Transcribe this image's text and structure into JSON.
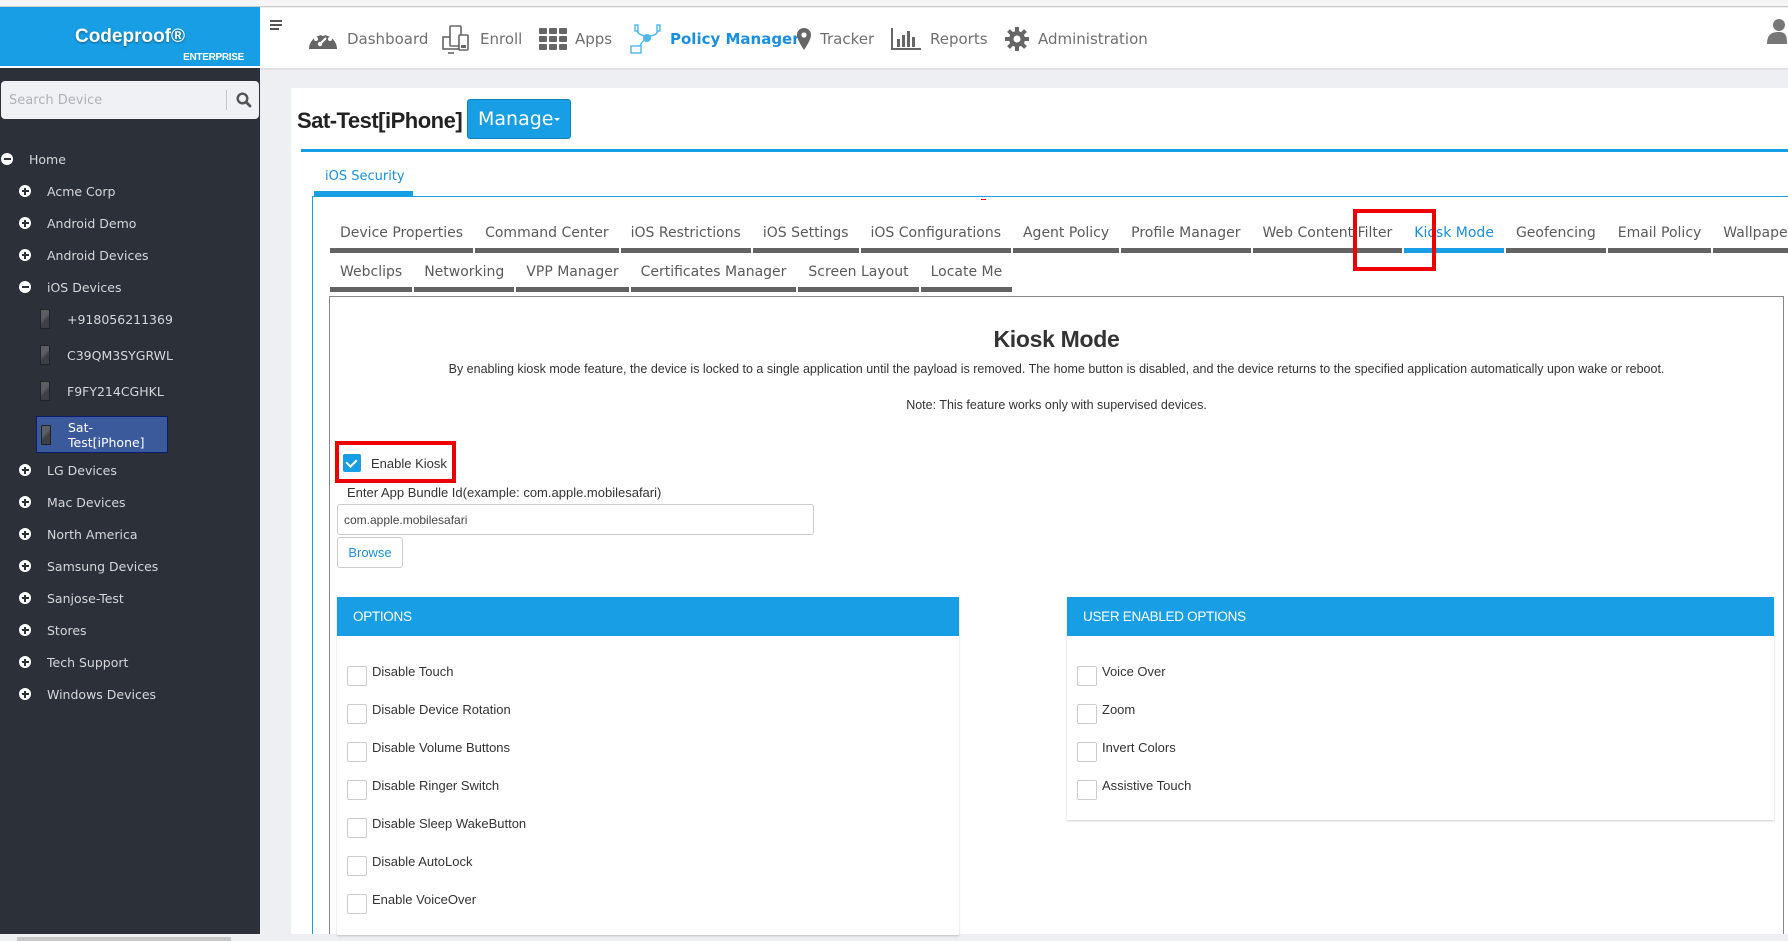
{
  "app": {
    "brand": "Codeproof®",
    "edition": "ENTERPRISE",
    "accent_color": "#189ee4",
    "highlight_color": "#ee0000"
  },
  "search": {
    "placeholder": "Search Device",
    "icon": "search-icon"
  },
  "sidebar": {
    "root": {
      "label": "Home",
      "icon": "collapse-icon"
    },
    "groups": [
      {
        "label": "Acme Corp",
        "icon": "expand-icon"
      },
      {
        "label": "Android Demo",
        "icon": "expand-icon"
      },
      {
        "label": "Android Devices",
        "icon": "expand-icon"
      },
      {
        "label": "iOS Devices",
        "icon": "collapse-icon"
      },
      {
        "label": "LG Devices",
        "icon": "expand-icon"
      },
      {
        "label": "Mac Devices",
        "icon": "expand-icon"
      },
      {
        "label": "North America",
        "icon": "expand-icon"
      },
      {
        "label": "Samsung Devices",
        "icon": "expand-icon"
      },
      {
        "label": "Sanjose-Test",
        "icon": "expand-icon"
      },
      {
        "label": "Stores",
        "icon": "expand-icon"
      },
      {
        "label": "Tech Support",
        "icon": "expand-icon"
      },
      {
        "label": "Windows Devices",
        "icon": "expand-icon"
      }
    ],
    "ios_devices": [
      {
        "label": "+918056211369",
        "selected": false
      },
      {
        "label": "C39QM3SYGRWL",
        "selected": false
      },
      {
        "label": "F9FY214CGHKL",
        "selected": false
      },
      {
        "label": "Sat-Test[iPhone]",
        "selected": true
      }
    ]
  },
  "topnav": {
    "menu_icon": "hamburger-icon",
    "items": [
      {
        "label": "Dashboard",
        "icon": "dashboard-gauge-icon",
        "active": false
      },
      {
        "label": "Enroll",
        "icon": "devices-icon",
        "active": false
      },
      {
        "label": "Apps",
        "icon": "apps-grid-icon",
        "active": false
      },
      {
        "label": "Policy Manager",
        "icon": "policy-network-icon",
        "active": true
      },
      {
        "label": "Tracker",
        "icon": "map-pin-icon",
        "active": false
      },
      {
        "label": "Reports",
        "icon": "bar-chart-icon",
        "active": false
      },
      {
        "label": "Administration",
        "icon": "gear-icon",
        "active": false
      }
    ],
    "user_icon": "user-icon"
  },
  "device": {
    "title": "Sat-Test[iPhone]",
    "manage_label": "Manage"
  },
  "section_tab": "iOS Security",
  "tabs_row1": [
    {
      "label": "Device Properties"
    },
    {
      "label": "Command Center"
    },
    {
      "label": "iOS Restrictions"
    },
    {
      "label": "iOS Settings"
    },
    {
      "label": "iOS Configurations"
    },
    {
      "label": "Agent Policy"
    },
    {
      "label": "Profile Manager"
    },
    {
      "label": "Web Content Filter"
    },
    {
      "label": "Kiosk Mode",
      "active": true
    },
    {
      "label": "Geofencing"
    },
    {
      "label": "Email Policy"
    },
    {
      "label": "Wallpaper"
    }
  ],
  "tabs_row2": [
    {
      "label": "Webclips"
    },
    {
      "label": "Networking"
    },
    {
      "label": "VPP Manager"
    },
    {
      "label": "Certificates Manager"
    },
    {
      "label": "Screen Layout"
    },
    {
      "label": "Locate Me"
    }
  ],
  "kiosk": {
    "title": "Kiosk Mode",
    "description": "By enabling kiosk mode feature, the device is locked to a single application until the payload is removed. The home button is disabled, and the device returns to the specified application automatically upon wake or reboot.",
    "note": "Note: This feature works only with supervised devices.",
    "enable_label": "Enable Kiosk",
    "enable_checked": true,
    "bundle_label": "Enter App Bundle Id(example: com.apple.mobilesafari)",
    "bundle_value": "com.apple.mobilesafari",
    "browse_label": "Browse"
  },
  "options": {
    "title": "OPTIONS",
    "items": [
      {
        "label": "Disable Touch",
        "checked": false
      },
      {
        "label": "Disable Device Rotation",
        "checked": false
      },
      {
        "label": "Disable Volume Buttons",
        "checked": false
      },
      {
        "label": "Disable Ringer Switch",
        "checked": false
      },
      {
        "label": "Disable Sleep WakeButton",
        "checked": false
      },
      {
        "label": "Disable AutoLock",
        "checked": false
      },
      {
        "label": "Enable VoiceOver",
        "checked": false
      }
    ]
  },
  "user_options": {
    "title": "USER ENABLED OPTIONS",
    "items": [
      {
        "label": "Voice Over",
        "checked": false
      },
      {
        "label": "Zoom",
        "checked": false
      },
      {
        "label": "Invert Colors",
        "checked": false
      },
      {
        "label": "Assistive Touch",
        "checked": false
      }
    ]
  }
}
